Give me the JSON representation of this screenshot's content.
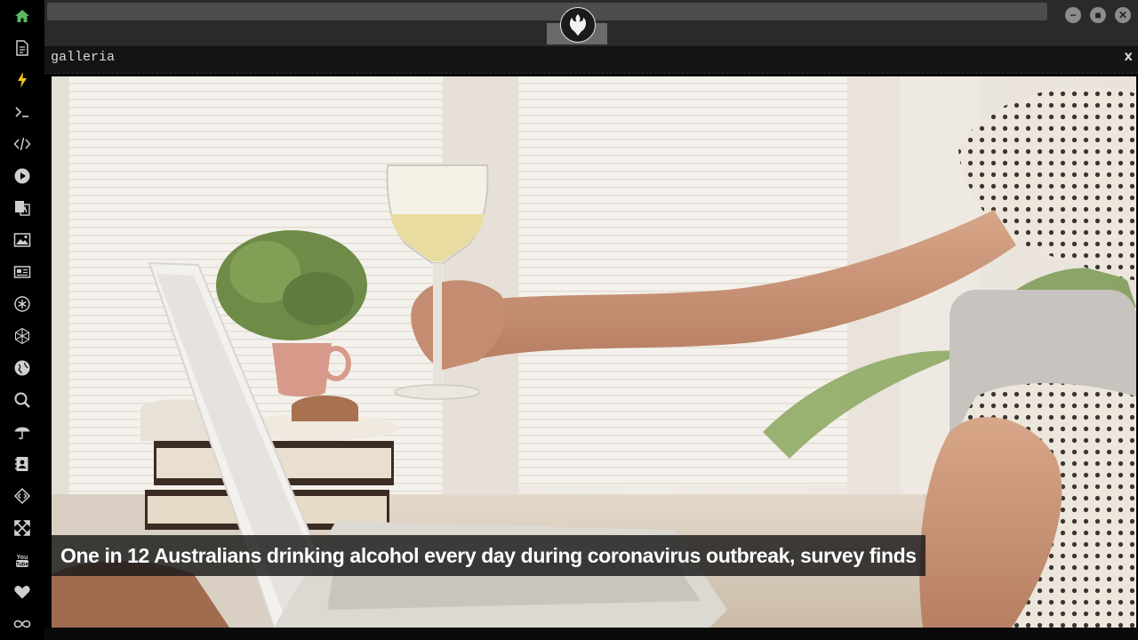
{
  "sidebar": {
    "items": [
      {
        "icon": "home-icon",
        "color": "#5cb85c"
      },
      {
        "icon": "document-icon",
        "color": "#cfcfcf"
      },
      {
        "icon": "lightning-icon",
        "color": "#f0c419"
      },
      {
        "icon": "terminal-icon",
        "color": "#cfcfcf"
      },
      {
        "icon": "code-icon",
        "color": "#cfcfcf"
      },
      {
        "icon": "play-icon",
        "color": "#cfcfcf"
      },
      {
        "icon": "translate-icon",
        "color": "#cfcfcf"
      },
      {
        "icon": "image-icon",
        "color": "#cfcfcf"
      },
      {
        "icon": "newspaper-icon",
        "color": "#cfcfcf"
      },
      {
        "icon": "asterisk-icon",
        "color": "#cfcfcf"
      },
      {
        "icon": "hexagon-icon",
        "color": "#cfcfcf"
      },
      {
        "icon": "globe-icon",
        "color": "#cfcfcf"
      },
      {
        "icon": "search-icon",
        "color": "#cfcfcf"
      },
      {
        "icon": "umbrella-icon",
        "color": "#cfcfcf"
      },
      {
        "icon": "contact-book-icon",
        "color": "#cfcfcf"
      },
      {
        "icon": "diamond-code-icon",
        "color": "#cfcfcf"
      },
      {
        "icon": "expand-icon",
        "color": "#cfcfcf"
      },
      {
        "icon": "youtube-icon",
        "color": "#cfcfcf"
      },
      {
        "icon": "heart-icon",
        "color": "#cfcfcf"
      },
      {
        "icon": "infinity-icon",
        "color": "#cfcfcf"
      }
    ]
  },
  "window": {
    "logo_icon": "rebel-alliance-icon",
    "minimize_label": "−",
    "maximize_label": "■",
    "close_label": "✕"
  },
  "app": {
    "title": "galleria",
    "close_label": "x"
  },
  "gallery": {
    "caption": "One in 12 Australians drinking alcohol every day during coronavirus outbreak, survey finds"
  },
  "colors": {
    "accent_green": "#5cb85c",
    "accent_yellow": "#f0c419",
    "topbar_bg": "#2a2a2a",
    "caption_bg": "#191919"
  }
}
